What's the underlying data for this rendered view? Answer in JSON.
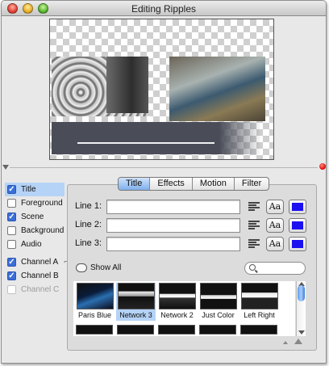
{
  "window": {
    "title": "Editing Ripples"
  },
  "layers": {
    "items": [
      {
        "label": "Title",
        "checked": true,
        "selected": true
      },
      {
        "label": "Foreground",
        "checked": false
      },
      {
        "label": "Scene",
        "checked": true
      },
      {
        "label": "Background",
        "checked": false
      },
      {
        "label": "Audio",
        "checked": false
      },
      {
        "label": "Channel A",
        "checked": true
      },
      {
        "label": "Channel B",
        "checked": true
      },
      {
        "label": "Channel C",
        "checked": false,
        "disabled": true
      }
    ]
  },
  "tabs": [
    "Title",
    "Effects",
    "Motion",
    "Filter"
  ],
  "active_tab": "Title",
  "lines": [
    {
      "label": "Line 1:",
      "value": "",
      "font_button": "Aa",
      "color": "#1a10f0"
    },
    {
      "label": "Line 2:",
      "value": "",
      "font_button": "Aa",
      "color": "#1a10f0"
    },
    {
      "label": "Line 3:",
      "value": "",
      "font_button": "Aa",
      "color": "#1a10f0"
    }
  ],
  "show_all": "Show All",
  "search": {
    "value": ""
  },
  "themes": [
    {
      "name": "Paris Blue"
    },
    {
      "name": "Network 3",
      "selected": true
    },
    {
      "name": "Network 2"
    },
    {
      "name": "Just Color"
    },
    {
      "name": "Left Right"
    }
  ],
  "icons": {
    "align": "align-left-icon",
    "search": "magnifier-icon",
    "show_all": "speech-bubble-icon",
    "zoom_small": "zoom-out-icon",
    "zoom_large": "zoom-in-icon"
  },
  "colors": {
    "accent": "#3b6fd8",
    "selection": "#b5d3f6",
    "text_color": "#1a10f0"
  }
}
